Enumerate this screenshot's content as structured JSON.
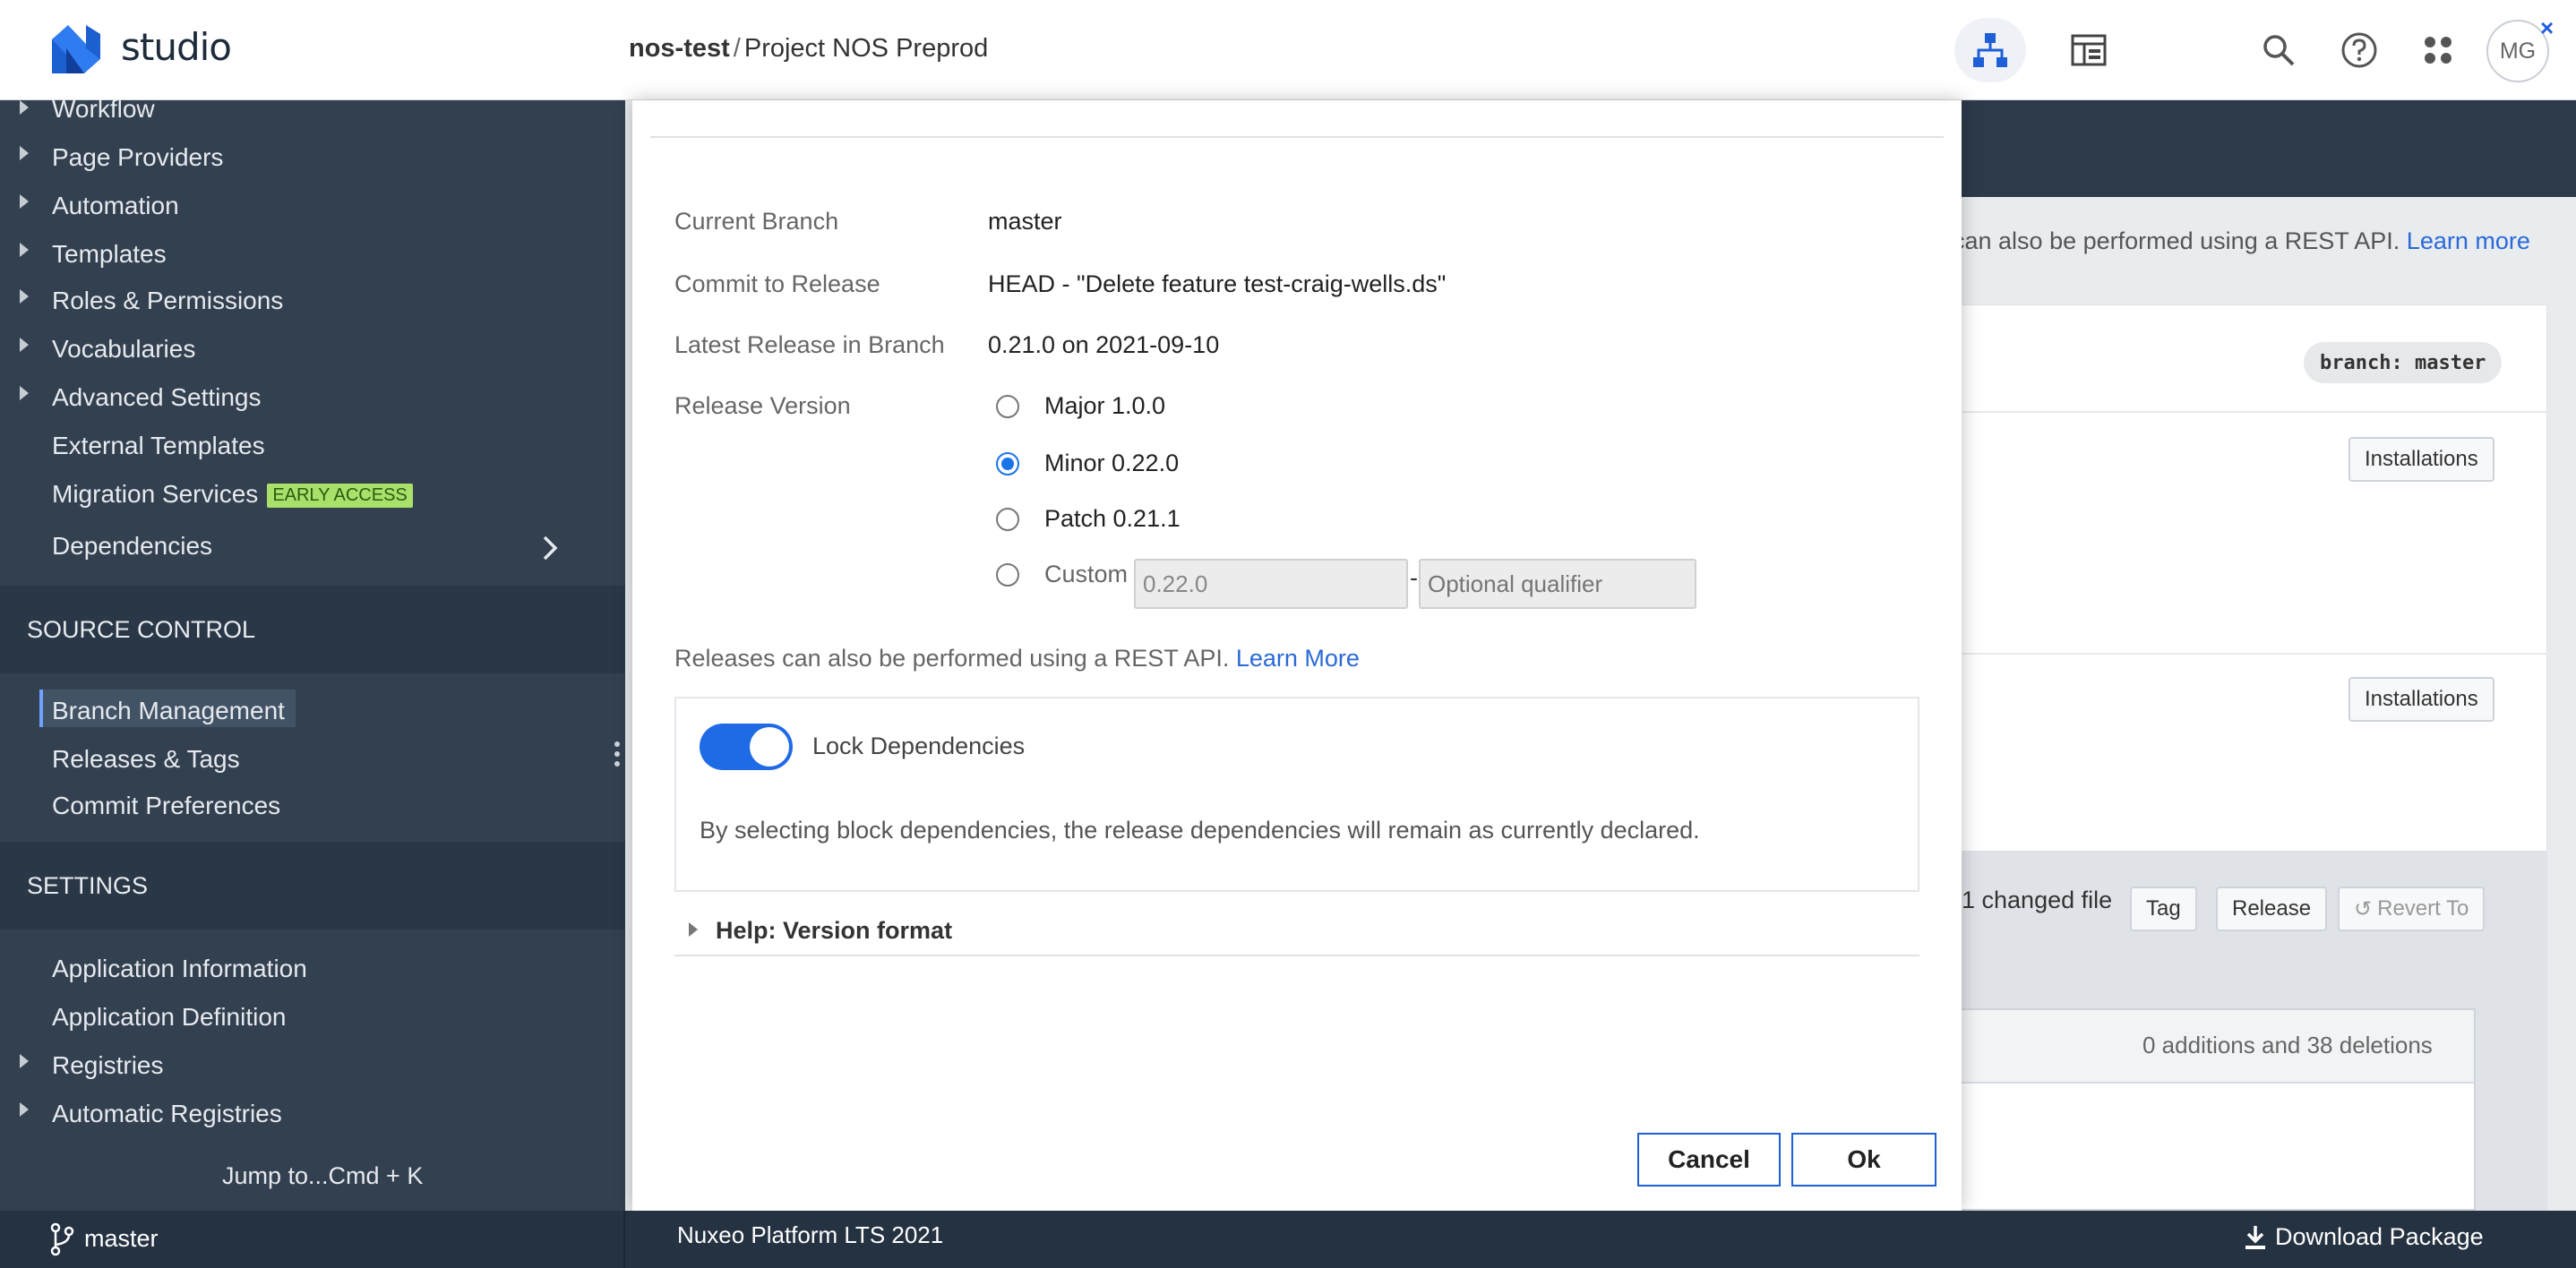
{
  "app": {
    "logo_text": "studio",
    "project_org": "nos-test",
    "project_sep": "/",
    "project_name": "Project NOS Preprod",
    "avatar_initials": "MG",
    "close_glyph": "×",
    "icons": [
      "branch-structure-icon",
      "layout-icon",
      "search-icon",
      "help-icon",
      "apps-grid-icon"
    ]
  },
  "sidebar": {
    "items": [
      {
        "label": "Workflow",
        "expandable": true
      },
      {
        "label": "Page Providers",
        "expandable": true
      },
      {
        "label": "Automation",
        "expandable": true
      },
      {
        "label": "Templates",
        "expandable": true
      },
      {
        "label": "Roles & Permissions",
        "expandable": true
      },
      {
        "label": "Vocabularies",
        "expandable": true
      },
      {
        "label": "Advanced Settings",
        "expandable": true
      },
      {
        "label": "External Templates",
        "expandable": false
      },
      {
        "label": "Migration Services",
        "expandable": false,
        "badge": "EARLY ACCESS"
      },
      {
        "label": "Dependencies",
        "expandable": false,
        "chevron": true
      }
    ],
    "source_control": {
      "title": "SOURCE CONTROL",
      "items": [
        "Branch Management",
        "Releases & Tags",
        "Commit Preferences"
      ],
      "active": "Branch Management"
    },
    "settings": {
      "title": "SETTINGS",
      "items": [
        {
          "label": "Application Information",
          "expandable": false
        },
        {
          "label": "Application Definition",
          "expandable": false
        },
        {
          "label": "Registries",
          "expandable": true
        },
        {
          "label": "Automatic Registries",
          "expandable": true
        }
      ]
    },
    "jump": "Jump to...Cmd + K"
  },
  "bottombar": {
    "branch": "master",
    "platform": "Nuxeo Platform LTS 2021",
    "download": "Download Package"
  },
  "background": {
    "info_text": "can also be performed using a REST API.",
    "info_link": "Learn more",
    "branch_pill": "branch: master",
    "installations_1": "Installations",
    "installations_2": "Installations",
    "changed": "1 changed file",
    "tag": "Tag",
    "release": "Release",
    "revert": "Revert To",
    "diff_summary": "0 additions and 38 deletions"
  },
  "modal": {
    "rows": [
      {
        "label": "Current Branch",
        "value": "master"
      },
      {
        "label": "Commit to Release",
        "value": "HEAD - \"Delete feature test-craig-wells.ds\""
      },
      {
        "label": "Latest Release in Branch",
        "value": "0.21.0 on 2021-09-10"
      }
    ],
    "release_version_label": "Release Version",
    "options": [
      {
        "label": "Major 1.0.0",
        "checked": false
      },
      {
        "label": "Minor 0.22.0",
        "checked": true
      },
      {
        "label": "Patch 0.21.1",
        "checked": false
      },
      {
        "label": "Custom",
        "checked": false
      }
    ],
    "custom_value": "0.22.0",
    "custom_dash": "-",
    "qualifier_placeholder": "Optional qualifier",
    "rest_text": "Releases can also be performed using a REST API.",
    "rest_link": "Learn More",
    "lock_label": "Lock Dependencies",
    "lock_on": true,
    "lock_desc": "By selecting block dependencies, the release dependencies will remain as currently declared.",
    "help_label": "Help: Version format",
    "cancel": "Cancel",
    "ok": "Ok"
  },
  "colors": {
    "sidebar_bg": "#334050",
    "section_bg": "#2a3746",
    "accent": "#1f6be6",
    "link": "#2a6ad8",
    "badge_bg": "#a8e06a"
  }
}
